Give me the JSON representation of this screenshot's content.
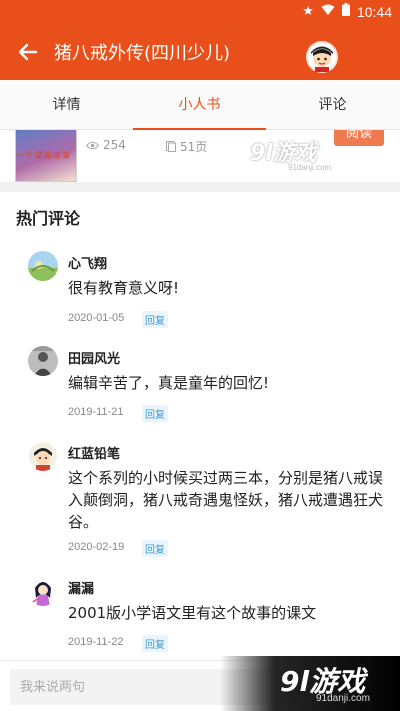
{
  "status_bar": {
    "time": "10:44"
  },
  "app_bar": {
    "title": "猪八戒外传(四川少儿)"
  },
  "tabs": [
    {
      "label": "详情",
      "active": false
    },
    {
      "label": "小人书",
      "active": true
    },
    {
      "label": "评论",
      "active": false
    }
  ],
  "book": {
    "cover_caption": "一个蜻蜓故事",
    "views": "254",
    "pages": "51页",
    "read_label": "阅读"
  },
  "comments_section": {
    "title": "热门评论"
  },
  "comments": [
    {
      "user": "心飞翔",
      "text": "很有教育意义呀!",
      "date": "2020-01-05",
      "reply": "回复"
    },
    {
      "user": "田园风光",
      "text": "编辑辛苦了，真是童年的回忆!",
      "date": "2019-11-21",
      "reply": "回复"
    },
    {
      "user": "红蓝铅笔",
      "text": "这个系列的小时候买过两三本，分别是猪八戒误入颠倒洞，猪八戒奇遇鬼怪妖，猪八戒遭遇狂犬谷。",
      "date": "2020-02-19",
      "reply": "回复"
    },
    {
      "user": "漏漏",
      "text": "2001版小学语文里有这个故事的课文",
      "date": "2019-11-22",
      "reply": "回复"
    }
  ],
  "input": {
    "placeholder": "我来说两句"
  },
  "watermark": {
    "logo": "9l游戏",
    "url": "91danji.com"
  },
  "colors": {
    "brand": "#e94f1b",
    "reply": "#3a9ad9"
  }
}
